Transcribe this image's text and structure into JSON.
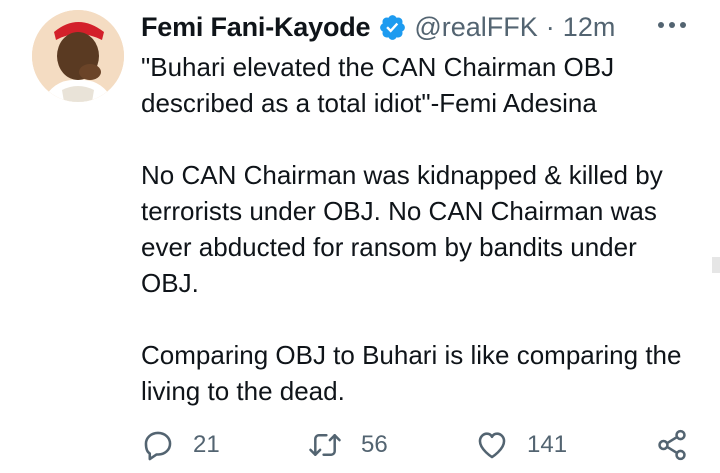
{
  "tweet": {
    "author_name": "Femi Fani-Kayode",
    "handle": "@realFFK",
    "separator": "·",
    "time": "12m",
    "paragraphs": [
      "\"Buhari elevated the CAN Chairman OBJ described as a total idiot\"-Femi Adesina",
      "No CAN Chairman was kidnapped & killed by terrorists under OBJ. No CAN Chairman was ever abducted for ransom by bandits under OBJ.",
      "Comparing OBJ to Buhari is like comparing the living to the dead."
    ]
  },
  "actions": {
    "reply_count": "21",
    "retweet_count": "56",
    "like_count": "141"
  },
  "icons": {
    "avatar": "profile-photo",
    "verified": "verified-badge-icon",
    "more": "more-options-icon",
    "reply": "reply-icon",
    "retweet": "retweet-icon",
    "like": "heart-icon",
    "share": "share-icon"
  },
  "colors": {
    "text_primary": "#0f1419",
    "text_secondary": "#536471",
    "verified_blue": "#1d9bf0"
  }
}
